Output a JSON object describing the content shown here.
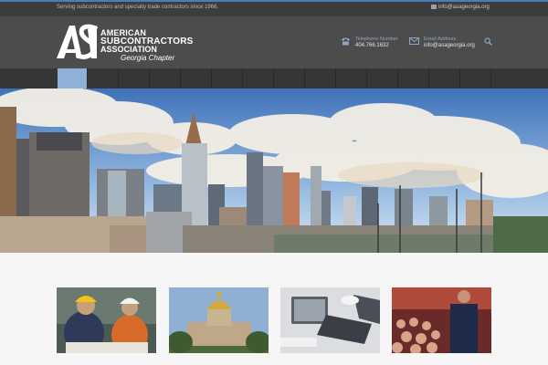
{
  "topbar": {
    "tagline": "Serving subcontractors and specialty trade contractors since 1966.",
    "email": "info@asageorgia.org",
    "email_icon": "envelope-icon"
  },
  "logo": {
    "line1": "AMERICAN",
    "line2": "SUBCONTRACTORS",
    "line3": "ASSOCIATION",
    "line4": "Georgia Chapter"
  },
  "contact": {
    "phone_label": "Telephone Number",
    "phone_value": "404.766.1632",
    "phone_icon": "phone-icon",
    "email_label": "Email Address",
    "email_value": "info@asageorgia.org",
    "email_icon": "envelope-icon",
    "search_icon": "search-icon"
  },
  "nav": {
    "active_index": 0,
    "accent": "#8fb0d8"
  },
  "hero": {
    "image": "atlanta-skyline-photo"
  },
  "tiles": [
    {
      "image": "construction-workers-photo"
    },
    {
      "image": "state-capitol-photo"
    },
    {
      "image": "laptop-desk-photo"
    },
    {
      "image": "conference-speaker-photo"
    }
  ],
  "colors": {
    "topbar_bg": "#3d3d3d",
    "header_bg": "#4c4c4c",
    "nav_bg": "#363636",
    "accent_blue": "#4a7cc0"
  }
}
